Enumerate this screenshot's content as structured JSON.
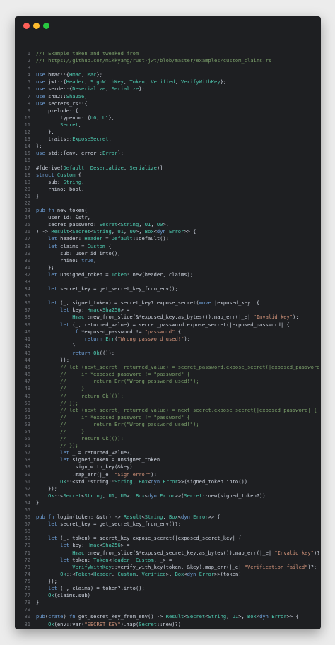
{
  "window": {
    "controls": [
      "close",
      "minimize",
      "maximize"
    ],
    "colors": {
      "background": "#1e1f22",
      "close": "#ff5f57",
      "minimize": "#febc2e",
      "maximize": "#28c840",
      "comment": "#7a9e6a",
      "keyword": "#6fa0d8",
      "string": "#ce9178",
      "type": "#4ec9b0",
      "line_number": "#6b6f76"
    }
  },
  "code": {
    "language": "rust",
    "lines": [
      {
        "n": "1",
        "text": "//! Example taken and tweaked from",
        "kind": "comment"
      },
      {
        "n": "2",
        "text": "//! https://github.com/mikkyang/rust-jwt/blob/master/examples/custom_claims.rs",
        "kind": "comment"
      },
      {
        "n": "3",
        "text": "",
        "kind": "code"
      },
      {
        "n": "4",
        "text": "use hmac::{Hmac, Mac};",
        "kind": "code"
      },
      {
        "n": "5",
        "text": "use jwt::{Header, SignWithKey, Token, Verified, VerifyWithKey};",
        "kind": "code"
      },
      {
        "n": "6",
        "text": "use serde::{Deserialize, Serialize};",
        "kind": "code"
      },
      {
        "n": "7",
        "text": "use sha2::Sha256;",
        "kind": "code"
      },
      {
        "n": "8",
        "text": "use secrets_rs::{",
        "kind": "code"
      },
      {
        "n": "9",
        "text": "    prelude::{",
        "kind": "code"
      },
      {
        "n": "10",
        "text": "        typenum::{U0, U1},",
        "kind": "code"
      },
      {
        "n": "11",
        "text": "        Secret,",
        "kind": "code"
      },
      {
        "n": "12",
        "text": "    },",
        "kind": "code"
      },
      {
        "n": "13",
        "text": "    traits::ExposeSecret,",
        "kind": "code"
      },
      {
        "n": "14",
        "text": "};",
        "kind": "code"
      },
      {
        "n": "15",
        "text": "use std::{env, error::Error};",
        "kind": "code"
      },
      {
        "n": "16",
        "text": "",
        "kind": "code"
      },
      {
        "n": "17",
        "text": "#[derive(Default, Deserialize, Serialize)]",
        "kind": "code"
      },
      {
        "n": "18",
        "text": "struct Custom {",
        "kind": "code"
      },
      {
        "n": "19",
        "text": "    sub: String,",
        "kind": "code"
      },
      {
        "n": "20",
        "text": "    rhino: bool,",
        "kind": "code"
      },
      {
        "n": "21",
        "text": "}",
        "kind": "code"
      },
      {
        "n": "22",
        "text": "",
        "kind": "code"
      },
      {
        "n": "23",
        "text": "pub fn new_token(",
        "kind": "code"
      },
      {
        "n": "24",
        "text": "    user_id: &str,",
        "kind": "code"
      },
      {
        "n": "25",
        "text": "    secret_password: Secret<String, U1, U0>,",
        "kind": "code"
      },
      {
        "n": "26",
        "text": ") -> Result<Secret<String, U1, U0>, Box<dyn Error>> {",
        "kind": "code"
      },
      {
        "n": "27",
        "text": "    let header: Header = Default::default();",
        "kind": "code"
      },
      {
        "n": "28",
        "text": "    let claims = Custom {",
        "kind": "code"
      },
      {
        "n": "29",
        "text": "        sub: user_id.into(),",
        "kind": "code"
      },
      {
        "n": "30",
        "text": "        rhino: true,",
        "kind": "code"
      },
      {
        "n": "31",
        "text": "    };",
        "kind": "code"
      },
      {
        "n": "32",
        "text": "    let unsigned_token = Token::new(header, claims);",
        "kind": "code"
      },
      {
        "n": "33",
        "text": "",
        "kind": "code"
      },
      {
        "n": "34",
        "text": "    let secret_key = get_secret_key_from_env();",
        "kind": "code"
      },
      {
        "n": "35",
        "text": "",
        "kind": "code"
      },
      {
        "n": "36",
        "text": "    let (_, signed_token) = secret_key?.expose_secret(move |exposed_key| {",
        "kind": "code"
      },
      {
        "n": "37",
        "text": "        let key: Hmac<Sha256> =",
        "kind": "code"
      },
      {
        "n": "38",
        "text": "            Hmac::new_from_slice(&*exposed_key.as_bytes()).map_err(|_e| \"Invalid key\");",
        "kind": "code"
      },
      {
        "n": "39",
        "text": "        let (_, returned_value) = secret_password.expose_secret(|exposed_password| {",
        "kind": "code"
      },
      {
        "n": "40",
        "text": "            if *exposed_password != \"password\" {",
        "kind": "code"
      },
      {
        "n": "41",
        "text": "                return Err(\"Wrong password used!\");",
        "kind": "code"
      },
      {
        "n": "42",
        "text": "            }",
        "kind": "code"
      },
      {
        "n": "43",
        "text": "            return Ok(());",
        "kind": "code"
      },
      {
        "n": "44",
        "text": "        });",
        "kind": "code"
      },
      {
        "n": "45",
        "text": "        // let (next_secret, returned_value) = secret_password.expose_secret(|exposed_password| {",
        "kind": "comment"
      },
      {
        "n": "46",
        "text": "        //     if *exposed_password != \"password\" {",
        "kind": "comment"
      },
      {
        "n": "47",
        "text": "        //         return Err(\"Wrong password used!\");",
        "kind": "comment"
      },
      {
        "n": "48",
        "text": "        //     }",
        "kind": "comment"
      },
      {
        "n": "49",
        "text": "        //     return Ok(());",
        "kind": "comment"
      },
      {
        "n": "50",
        "text": "        // });",
        "kind": "comment"
      },
      {
        "n": "51",
        "text": "        // let (next_secret, returned_value) = next_secret.expose_secret(|exposed_password| {",
        "kind": "comment"
      },
      {
        "n": "52",
        "text": "        //     if *exposed_password != \"password\" {",
        "kind": "comment"
      },
      {
        "n": "53",
        "text": "        //         return Err(\"Wrong password used!\");",
        "kind": "comment"
      },
      {
        "n": "54",
        "text": "        //     }",
        "kind": "comment"
      },
      {
        "n": "55",
        "text": "        //     return Ok(());",
        "kind": "comment"
      },
      {
        "n": "56",
        "text": "        // });",
        "kind": "comment"
      },
      {
        "n": "57",
        "text": "        let _ = returned_value?;",
        "kind": "code"
      },
      {
        "n": "58",
        "text": "        let signed_token = unsigned_token",
        "kind": "code"
      },
      {
        "n": "59",
        "text": "            .sign_with_key(&key)",
        "kind": "code"
      },
      {
        "n": "60",
        "text": "            .map_err(|_e| \"Sign error\");",
        "kind": "code"
      },
      {
        "n": "61",
        "text": "        Ok::<std::string::String, Box<dyn Error>>(signed_token.into())",
        "kind": "code"
      },
      {
        "n": "62",
        "text": "    });",
        "kind": "code"
      },
      {
        "n": "63",
        "text": "    Ok::<Secret<String, U1, U0>, Box<dyn Error>>(Secret::new(signed_token?))",
        "kind": "code"
      },
      {
        "n": "64",
        "text": "}",
        "kind": "code"
      },
      {
        "n": "65",
        "text": "",
        "kind": "code"
      },
      {
        "n": "66",
        "text": "pub fn login(token: &str) -> Result<String, Box<dyn Error>> {",
        "kind": "code"
      },
      {
        "n": "67",
        "text": "    let secret_key = get_secret_key_from_env()?;",
        "kind": "code"
      },
      {
        "n": "68",
        "text": "",
        "kind": "code"
      },
      {
        "n": "69",
        "text": "    let (_, token) = secret_key.expose_secret(|exposed_secret_key| {",
        "kind": "code"
      },
      {
        "n": "70",
        "text": "        let key: Hmac<Sha256> =",
        "kind": "code"
      },
      {
        "n": "71",
        "text": "            Hmac::new_from_slice(&*exposed_secret_key.as_bytes()).map_err(|_e| \"Invalid key\")?;",
        "kind": "code"
      },
      {
        "n": "72",
        "text": "        let token: Token<Header, Custom, _> =",
        "kind": "code"
      },
      {
        "n": "73",
        "text": "            VerifyWithKey::verify_with_key(token, &key).map_err(|_e| \"Verification failed\")?;",
        "kind": "code"
      },
      {
        "n": "74",
        "text": "        Ok::<Token<Header, Custom, Verified>, Box<dyn Error>>(token)",
        "kind": "code"
      },
      {
        "n": "75",
        "text": "    });",
        "kind": "code"
      },
      {
        "n": "76",
        "text": "    let (_, claims) = token?.into();",
        "kind": "code"
      },
      {
        "n": "77",
        "text": "    Ok(claims.sub)",
        "kind": "code"
      },
      {
        "n": "78",
        "text": "}",
        "kind": "code"
      },
      {
        "n": "79",
        "text": "",
        "kind": "code"
      },
      {
        "n": "80",
        "text": "pub(crate) fn get_secret_key_from_env() -> Result<Secret<String, U1>, Box<dyn Error>> {",
        "kind": "code"
      },
      {
        "n": "81",
        "text": "    Ok(env::var(\"SECRET_KEY\").map(Secret::new)?)",
        "kind": "code"
      },
      {
        "n": "82",
        "text": "}",
        "kind": "code"
      },
      {
        "n": "83",
        "text": "",
        "kind": "code"
      }
    ]
  }
}
